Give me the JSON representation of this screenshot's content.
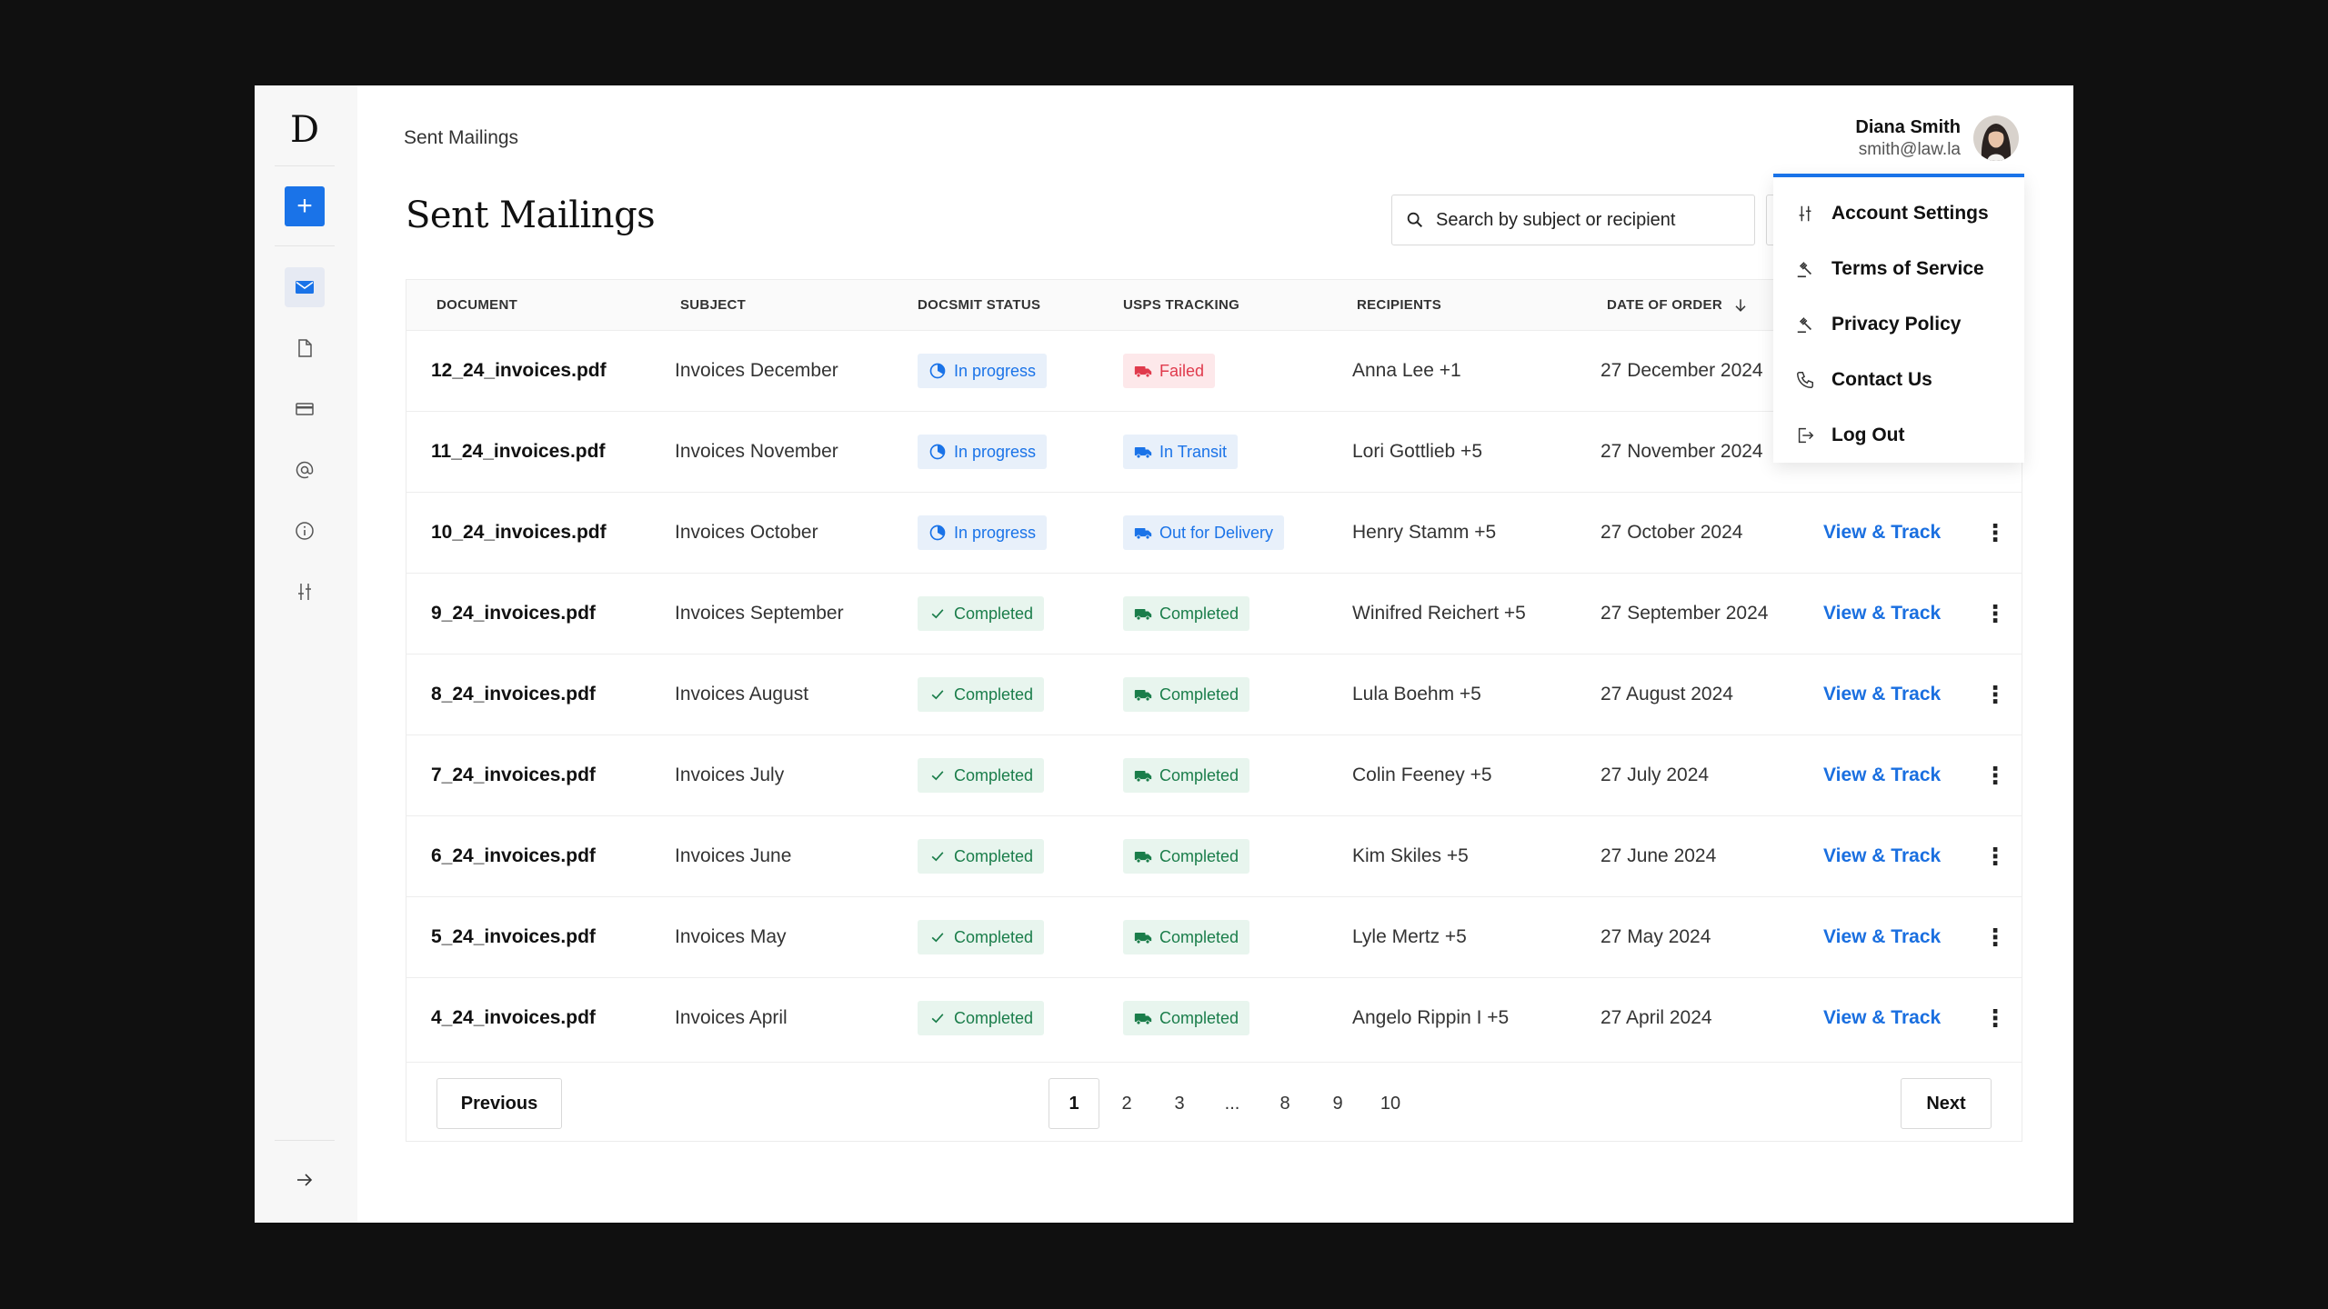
{
  "brand": {
    "logo": "D"
  },
  "breadcrumb": "Sent Mailings",
  "page_title": "Sent Mailings",
  "search": {
    "placeholder": "Search by subject or recipient"
  },
  "user": {
    "name": "Diana Smith",
    "email": "smith@law.la"
  },
  "sidebar": {
    "new_label": "+",
    "items": [
      {
        "name": "mail-icon",
        "active": true
      },
      {
        "name": "document-icon",
        "active": false
      },
      {
        "name": "card-icon",
        "active": false
      },
      {
        "name": "at-icon",
        "active": false
      },
      {
        "name": "info-icon",
        "active": false
      },
      {
        "name": "sliders-icon",
        "active": false
      }
    ],
    "collapse_icon": "arrow-right-icon"
  },
  "table": {
    "headers": {
      "document": "DOCUMENT",
      "subject": "SUBJECT",
      "docsmit_status": "DOCSMIT STATUS",
      "usps_tracking": "USPS TRACKING",
      "recipients": "RECIPIENTS",
      "date_of_order": "DATE OF ORDER"
    },
    "rows": [
      {
        "document": "12_24_invoices.pdf",
        "subject": "Invoices December",
        "status": "In progress",
        "tracking": "Failed",
        "recipients": "Anna Lee +1",
        "date": "27 December 2024",
        "action": "",
        "menu": ""
      },
      {
        "document": "11_24_invoices.pdf",
        "subject": "Invoices November",
        "status": "In progress",
        "tracking": "In Transit",
        "recipients": "Lori Gottlieb +5",
        "date": "27 November 2024",
        "action": "",
        "menu": ""
      },
      {
        "document": "10_24_invoices.pdf",
        "subject": "Invoices October",
        "status": "In progress",
        "tracking": "Out for Delivery",
        "recipients": "Henry Stamm +5",
        "date": "27 October 2024",
        "action": "View & Track",
        "menu": "⋮"
      },
      {
        "document": "9_24_invoices.pdf",
        "subject": "Invoices September",
        "status": "Completed",
        "tracking": "Completed",
        "recipients": "Winifred Reichert +5",
        "date": "27 September 2024",
        "action": "View & Track",
        "menu": "⋮"
      },
      {
        "document": "8_24_invoices.pdf",
        "subject": "Invoices August",
        "status": "Completed",
        "tracking": "Completed",
        "recipients": "Lula Boehm +5",
        "date": "27 August 2024",
        "action": "View & Track",
        "menu": "⋮"
      },
      {
        "document": "7_24_invoices.pdf",
        "subject": "Invoices July",
        "status": "Completed",
        "tracking": "Completed",
        "recipients": "Colin Feeney +5",
        "date": "27 July 2024",
        "action": "View & Track",
        "menu": "⋮"
      },
      {
        "document": "6_24_invoices.pdf",
        "subject": "Invoices June",
        "status": "Completed",
        "tracking": "Completed",
        "recipients": "Kim Skiles +5",
        "date": "27 June 2024",
        "action": "View & Track",
        "menu": "⋮"
      },
      {
        "document": "5_24_invoices.pdf",
        "subject": "Invoices May",
        "status": "Completed",
        "tracking": "Completed",
        "recipients": "Lyle Mertz +5",
        "date": "27 May 2024",
        "action": "View & Track",
        "menu": "⋮"
      },
      {
        "document": "4_24_invoices.pdf",
        "subject": "Invoices April",
        "status": "Completed",
        "tracking": "Completed",
        "recipients": "Angelo Rippin I +5",
        "date": "27 April 2024",
        "action": "View & Track",
        "menu": "⋮"
      }
    ]
  },
  "pagination": {
    "previous": "Previous",
    "next": "Next",
    "pages": [
      "1",
      "2",
      "3",
      "...",
      "8",
      "9",
      "10"
    ],
    "current": "1"
  },
  "user_menu": {
    "items": [
      {
        "label": "Account Settings",
        "icon": "sliders-icon"
      },
      {
        "label": "Terms of Service",
        "icon": "gavel-icon"
      },
      {
        "label": "Privacy Policy",
        "icon": "gavel-icon"
      },
      {
        "label": "Contact Us",
        "icon": "phone-icon"
      },
      {
        "label": "Log Out",
        "icon": "logout-icon"
      }
    ]
  },
  "colors": {
    "accent": "#1a73e8",
    "failed": "#e03a4c",
    "completed": "#1a7d4a"
  }
}
